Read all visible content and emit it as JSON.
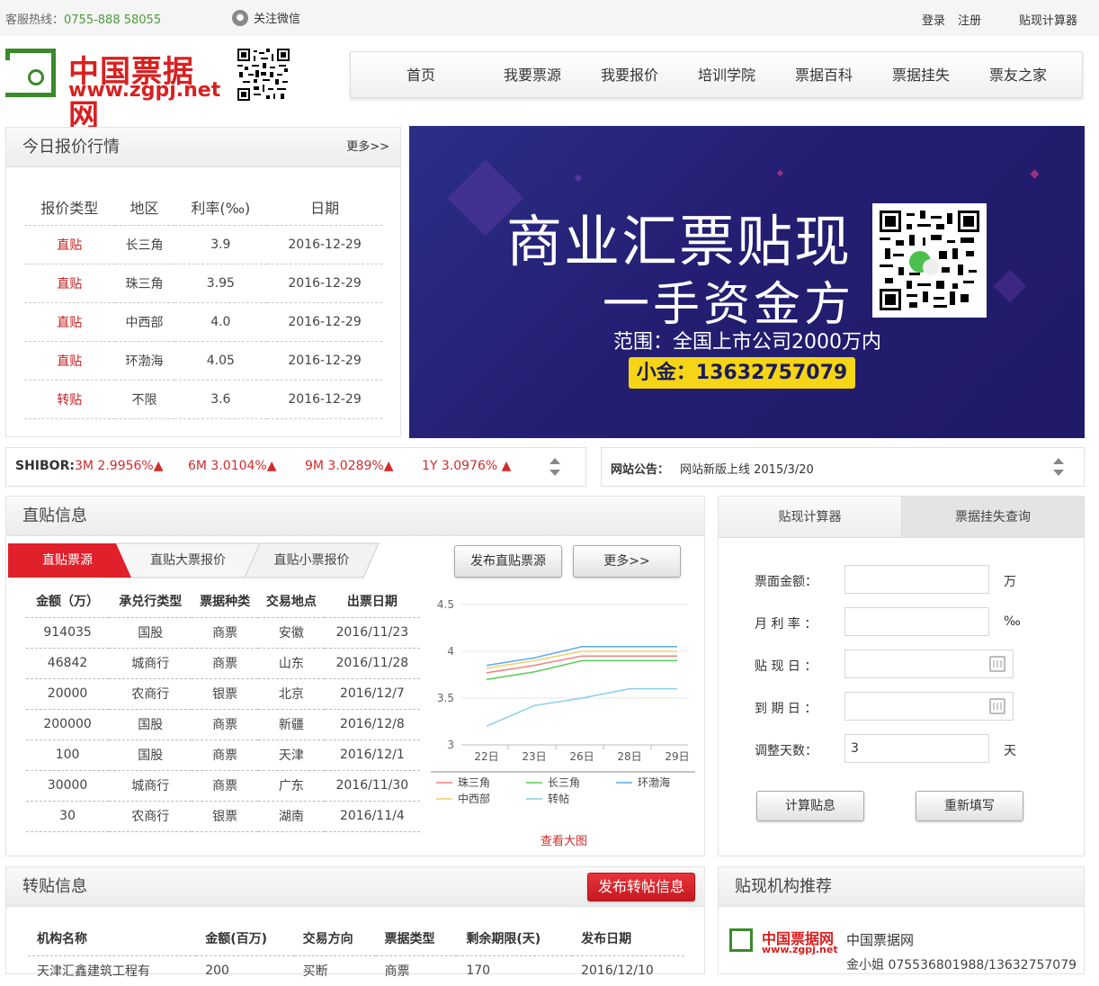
{
  "topbar": {
    "hotline_label": "客服热线：",
    "hotline_number": "0755-888 58055",
    "wechat": "关注微信",
    "login": "登录",
    "register": "注册",
    "calculator": "贴现计算器"
  },
  "logo": {
    "cn": "中国票据网",
    "en": "www.zgpj.net"
  },
  "nav": [
    "首页",
    "我要票源",
    "我要报价",
    "培训学院",
    "票据百科",
    "票据挂失",
    "票友之家"
  ],
  "quote": {
    "title": "今日报价行情",
    "more": "更多>>",
    "headers": [
      "报价类型",
      "地区",
      "利率(‰)",
      "日期"
    ],
    "rows": [
      [
        "直贴",
        "长三角",
        "3.9",
        "2016-12-29"
      ],
      [
        "直贴",
        "珠三角",
        "3.95",
        "2016-12-29"
      ],
      [
        "直贴",
        "中西部",
        "4.0",
        "2016-12-29"
      ],
      [
        "直贴",
        "环渤海",
        "4.05",
        "2016-12-29"
      ],
      [
        "转贴",
        "不限",
        "3.6",
        "2016-12-29"
      ]
    ]
  },
  "banner": {
    "line1": "商业汇票贴现",
    "line2": "一手资金方",
    "line3": "范围：全国上市公司2000万内",
    "contact": "小金：13632757079"
  },
  "shibor": {
    "label": "SHIBOR:",
    "items": [
      "3M 2.9956%▲",
      "6M 3.0104%▲",
      "9M 3.0289%▲",
      "1Y 3.0976% ▲"
    ]
  },
  "notice": {
    "label": "网站公告：",
    "text": "网站新版上线 2015/3/20"
  },
  "direct": {
    "title": "直贴信息",
    "tabs": [
      "直贴票源",
      "直贴大票报价",
      "直贴小票报价"
    ],
    "publish": "发布直贴票源",
    "more": "更多>>",
    "headers": [
      "金额（万）",
      "承兑行类型",
      "票据种类",
      "交易地点",
      "出票日期"
    ],
    "rows": [
      [
        "914035",
        "国股",
        "商票",
        "安徽",
        "2016/11/23"
      ],
      [
        "46842",
        "城商行",
        "商票",
        "山东",
        "2016/11/28"
      ],
      [
        "20000",
        "农商行",
        "银票",
        "北京",
        "2016/12/7"
      ],
      [
        "200000",
        "国股",
        "商票",
        "新疆",
        "2016/12/8"
      ],
      [
        "100",
        "国股",
        "商票",
        "天津",
        "2016/12/1"
      ],
      [
        "30000",
        "城商行",
        "商票",
        "广东",
        "2016/11/30"
      ],
      [
        "30",
        "农商行",
        "银票",
        "湖南",
        "2016/11/4"
      ]
    ],
    "view_large": "查看大图"
  },
  "chart_data": {
    "type": "line",
    "categories": [
      "22日",
      "23日",
      "26日",
      "28日",
      "29日"
    ],
    "ylim": [
      3,
      4.5
    ],
    "yticks": [
      "4.5",
      "4",
      "3.5",
      "3"
    ],
    "series": [
      {
        "name": "珠三角",
        "color": "#f28080",
        "values": [
          3.77,
          3.85,
          3.95,
          3.95,
          3.95
        ]
      },
      {
        "name": "长三角",
        "color": "#55cc55",
        "values": [
          3.7,
          3.78,
          3.9,
          3.9,
          3.9
        ]
      },
      {
        "name": "环渤海",
        "color": "#5aaaee",
        "values": [
          3.85,
          3.93,
          4.05,
          4.05,
          4.05
        ]
      },
      {
        "name": "中西部",
        "color": "#f0d070",
        "values": [
          3.82,
          3.9,
          4.0,
          4.0,
          4.0
        ]
      },
      {
        "name": "转帖",
        "color": "#88ccee",
        "values": [
          3.2,
          3.42,
          3.5,
          3.6,
          3.6
        ]
      }
    ]
  },
  "calc": {
    "tab1": "贴现计算器",
    "tab2": "票据挂失查询",
    "face_label": "票面金额：",
    "face_unit": "万",
    "rate_label": "月 利 率 ：",
    "rate_unit": "‰",
    "disc_label": "贴 现 日 ：",
    "due_label": "到 期 日 ：",
    "adj_label": "调整天数：",
    "adj_value": "3",
    "adj_unit": "天",
    "calc_btn": "计算贴息",
    "reset_btn": "重新填写"
  },
  "transfer": {
    "title": "转贴信息",
    "publish": "发布转帖信息",
    "headers": [
      "机构名称",
      "金额(百万)",
      "交易方向",
      "票据类型",
      "剩余期限(天)",
      "发布日期"
    ],
    "row": [
      "天津汇鑫建筑工程有",
      "200",
      "买断",
      "商票",
      "170",
      "2016/12/10"
    ]
  },
  "org": {
    "title": "贴现机构推荐",
    "name": "中国票据网",
    "contact": "金小姐 075536801988/13632757079"
  }
}
